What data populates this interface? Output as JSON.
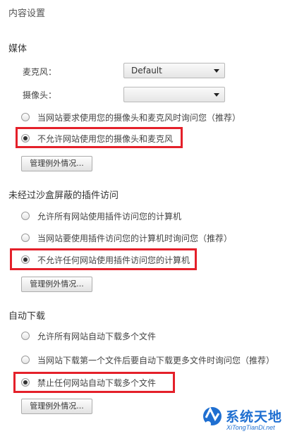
{
  "page_title": "内容设置",
  "media": {
    "heading": "媒体",
    "mic_label": "麦克风：",
    "mic_value": "Default",
    "camera_label": "摄像头：",
    "camera_value": "",
    "options": [
      "当网站要求使用您的摄像头和麦克风时询问您（推荐）",
      "不允许网站使用您的摄像头和麦克风"
    ],
    "selected_index": 1,
    "manage_button": "管理例外情况..."
  },
  "plugins": {
    "heading": "未经过沙盒屏蔽的插件访问",
    "options": [
      "允许所有网站使用插件访问您的计算机",
      "当网站要使用插件访问您的计算机时询问您（推荐）",
      "不允许任何网站使用插件访问您的计算机"
    ],
    "selected_index": 2,
    "manage_button": "管理例外情况..."
  },
  "downloads": {
    "heading": "自动下载",
    "options": [
      "允许所有网站自动下载多个文件",
      "当网站下载第一个文件后要自动下载更多文件时询问您（推荐）",
      "禁止任何网站自动下载多个文件"
    ],
    "selected_index": 2,
    "manage_button": "管理例外情况..."
  },
  "watermark": {
    "name": "系统天地",
    "url": "XiTongTianDi.net"
  },
  "colors": {
    "highlight": "#e4202a",
    "logo_blue": "#1f6fd1"
  }
}
